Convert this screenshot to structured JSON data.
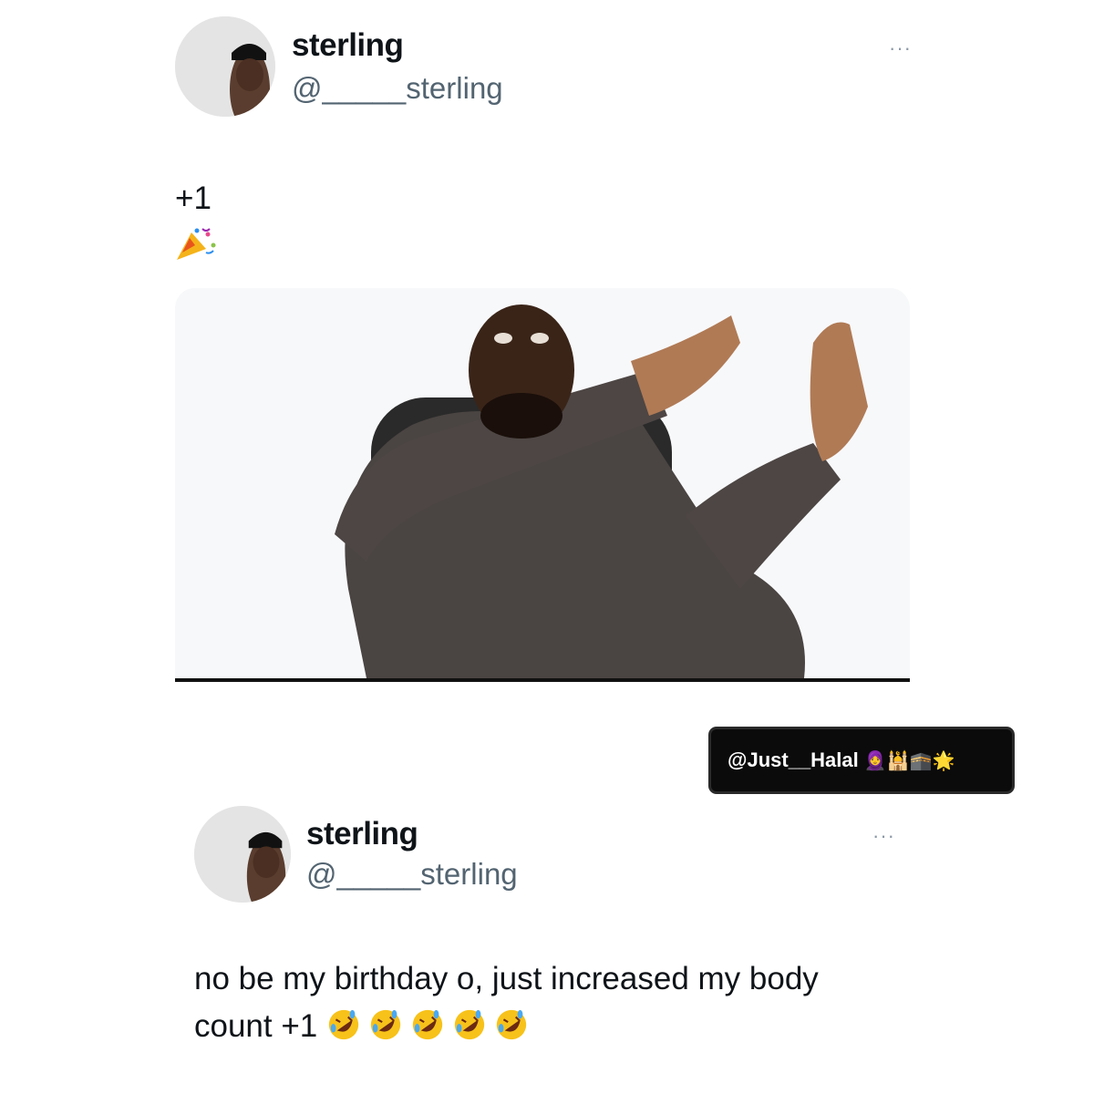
{
  "tweet1": {
    "name": "sterling",
    "handle": "@_____sterling",
    "text": "+1",
    "text_emoji": "party-popper"
  },
  "tweet2": {
    "name": "sterling",
    "handle": "@_____sterling",
    "text_line1": "no be my birthday o, just increased my body",
    "text_line2": "count +1",
    "text_emoji": [
      "rolling-laughing",
      "rolling-laughing",
      "rolling-laughing",
      "rolling-laughing",
      "rolling-laughing"
    ]
  },
  "more_label": "···",
  "watermark": {
    "handle": "@Just__Halal",
    "emojis": "🧕🕌🕋🌟"
  },
  "colors": {
    "name": "#0f1419",
    "handle": "#536471",
    "background": "#ffffff"
  }
}
